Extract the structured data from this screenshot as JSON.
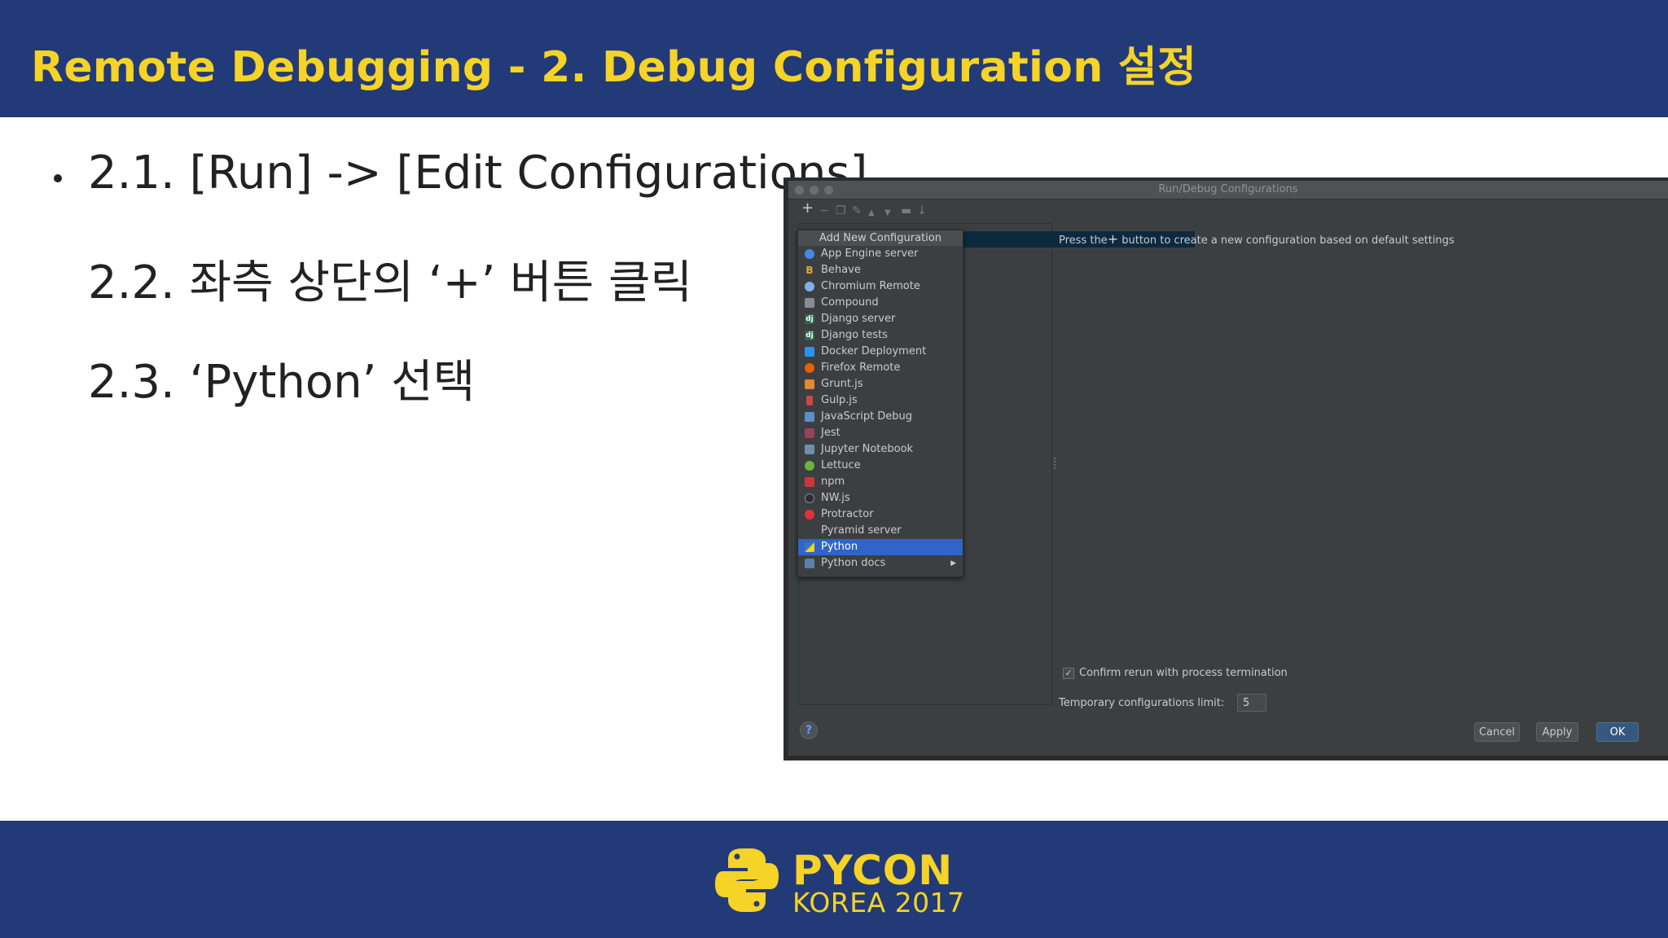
{
  "slide": {
    "title": "Remote Debugging - 2. Debug Configuration 설정",
    "steps": [
      "2.1. [Run] -> [Edit Configurations]",
      "2.2. 좌측 상단의 ‘+’ 버튼 클릭",
      "2.3. ‘Python’ 선택"
    ],
    "logo": {
      "word": "PYCON",
      "sub": "KOREA 2017"
    },
    "colors": {
      "band": "#233a78",
      "accent": "#f5d327"
    }
  },
  "dialog": {
    "title": "Run/Debug Configurations",
    "toolbar_icons": [
      "plus-icon",
      "minus-icon",
      "copy-icon",
      "wrench-icon",
      "arrow-up-icon",
      "arrow-down-icon",
      "folder-icon",
      "sort-icon"
    ],
    "menu": {
      "header": "Add New Configuration",
      "items": [
        {
          "label": "App Engine server",
          "icon": "app-engine-icon"
        },
        {
          "label": "Behave",
          "icon": "behave-icon"
        },
        {
          "label": "Chromium Remote",
          "icon": "chromium-icon"
        },
        {
          "label": "Compound",
          "icon": "compound-icon"
        },
        {
          "label": "Django server",
          "icon": "django-icon"
        },
        {
          "label": "Django tests",
          "icon": "django-tests-icon"
        },
        {
          "label": "Docker Deployment",
          "icon": "docker-icon"
        },
        {
          "label": "Firefox Remote",
          "icon": "firefox-icon"
        },
        {
          "label": "Grunt.js",
          "icon": "grunt-icon"
        },
        {
          "label": "Gulp.js",
          "icon": "gulp-icon"
        },
        {
          "label": "JavaScript Debug",
          "icon": "javascript-debug-icon"
        },
        {
          "label": "Jest",
          "icon": "jest-icon"
        },
        {
          "label": "Jupyter Notebook",
          "icon": "jupyter-icon"
        },
        {
          "label": "Lettuce",
          "icon": "lettuce-icon"
        },
        {
          "label": "npm",
          "icon": "npm-icon"
        },
        {
          "label": "NW.js",
          "icon": "nwjs-icon"
        },
        {
          "label": "Protractor",
          "icon": "protractor-icon"
        },
        {
          "label": "Pyramid server",
          "icon": "pyramid-icon"
        },
        {
          "label": "Python",
          "icon": "python-icon",
          "selected": true
        },
        {
          "label": "Python docs",
          "icon": "python-docs-icon",
          "submenu": true
        }
      ]
    },
    "hint_before": "Press the",
    "hint_after": " button to create a new configuration based on default settings",
    "confirm_rerun": {
      "label": "Confirm rerun with process termination",
      "checked": true
    },
    "temp_limit": {
      "label": "Temporary configurations limit:",
      "value": "5"
    },
    "buttons": {
      "cancel": "Cancel",
      "apply": "Apply",
      "ok": "OK"
    }
  }
}
